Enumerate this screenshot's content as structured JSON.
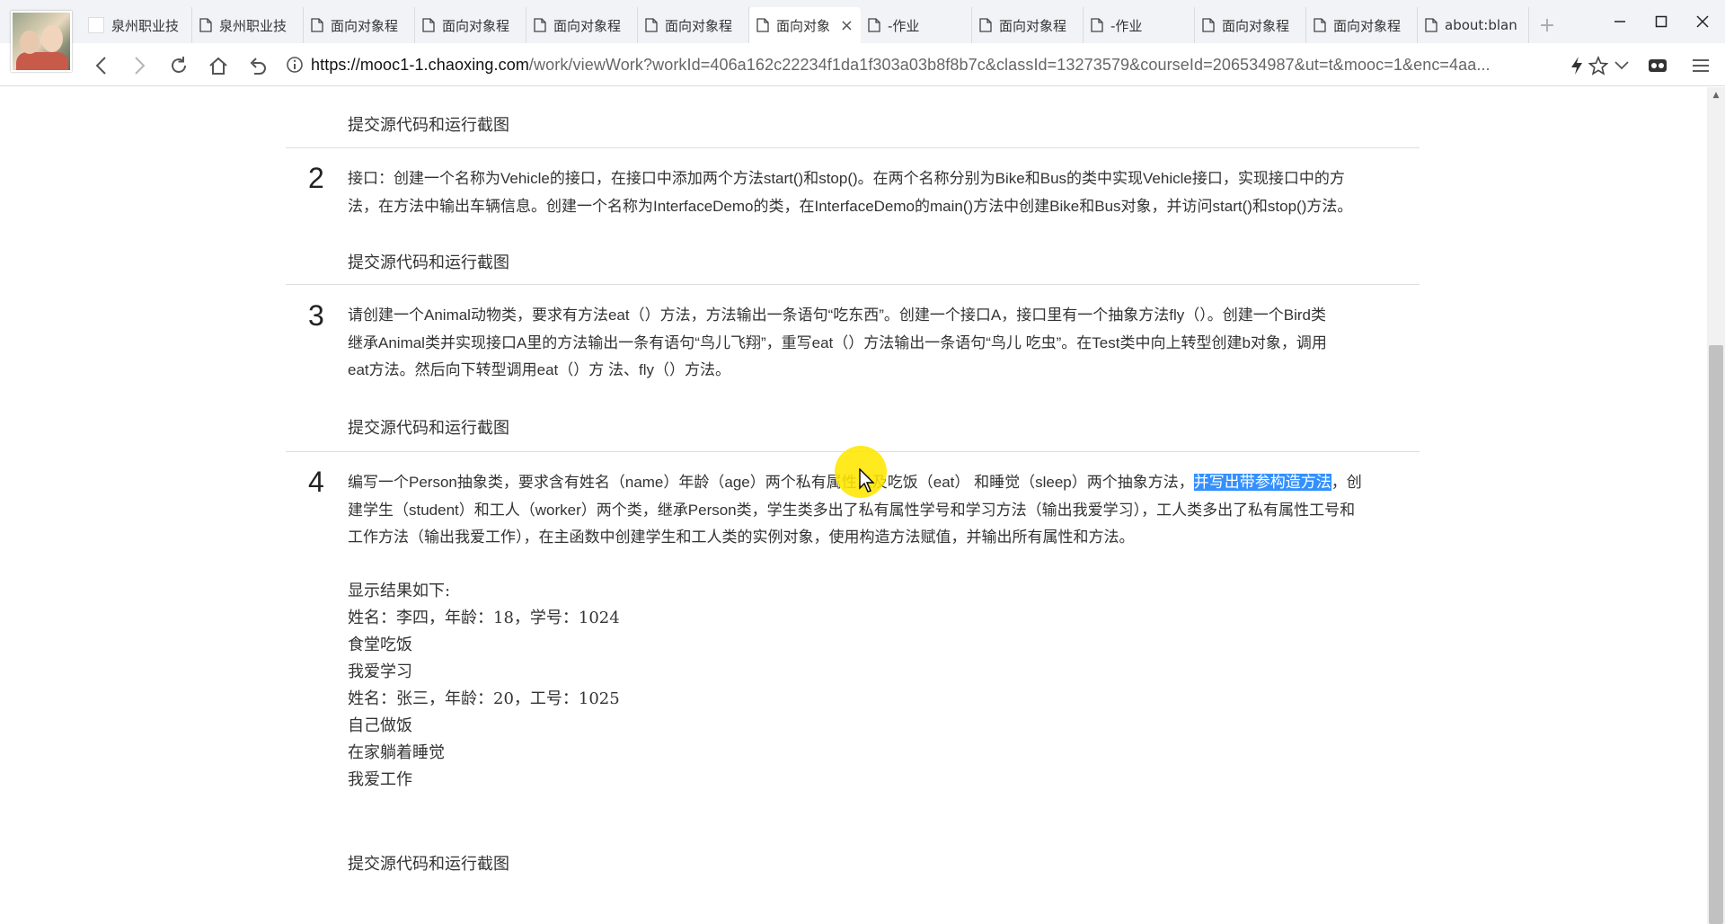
{
  "browser": {
    "tabs": [
      {
        "label": "泉州职业技",
        "icon": "blank-page-icon",
        "active": false
      },
      {
        "label": "泉州职业技",
        "icon": "document-icon",
        "active": false
      },
      {
        "label": "面向对象程",
        "icon": "document-icon",
        "active": false
      },
      {
        "label": "面向对象程",
        "icon": "document-icon",
        "active": false
      },
      {
        "label": "面向对象程",
        "icon": "document-icon",
        "active": false
      },
      {
        "label": "面向对象程",
        "icon": "document-icon",
        "active": false
      },
      {
        "label": "面向对象",
        "icon": "document-icon",
        "active": true
      },
      {
        "label": "-作业",
        "icon": "document-icon",
        "active": false
      },
      {
        "label": "面向对象程",
        "icon": "document-icon",
        "active": false
      },
      {
        "label": "-作业",
        "icon": "document-icon",
        "active": false
      },
      {
        "label": "面向对象程",
        "icon": "document-icon",
        "active": false
      },
      {
        "label": "面向对象程",
        "icon": "document-icon",
        "active": false
      },
      {
        "label": "about:blan",
        "icon": "document-icon",
        "active": false
      }
    ],
    "new_tab_label": "+",
    "tab_close_label": "×",
    "url_host": "https://mooc1-1.chaoxing.com",
    "url_rest": "/work/viewWork?workId=406a162c22234f1da1f303a03b8f8b7c&classId=13273579&courseId=206534987&ut=t&mooc=1&enc=4aa...",
    "accent_color": "#3390ff"
  },
  "page": {
    "submit_label": "提交源代码和运行截图",
    "questions": [
      {
        "number": "2",
        "lines": [
          " 接口：创建一个名称为Vehicle的接口，在接口中添加两个方法start()和stop()。在两个名称分别为Bike和Bus的类中实现Vehicle接口，实现接口中的方",
          "法，在方法中输出车辆信息。创建一个名称为InterfaceDemo的类，在InterfaceDemo的main()方法中创建Bike和Bus对象，并访问start()和stop()方法。"
        ]
      },
      {
        "number": "3",
        "lines": [
          "请创建一个Animal动物类，要求有方法eat（）方法，方法输出一条语句“吃东西”。创建一个接口A，接口里有一个抽象方法fly（）。创建一个Bird类",
          "继承Animal类并实现接口A里的方法输出一条有语句“鸟儿飞翔”，重写eat（）方法输出一条语句“鸟儿 吃虫”。在Test类中向上转型创建b对象，调用",
          "eat方法。然后向下转型调用eat（）方 法、fly（）方法。"
        ]
      },
      {
        "number": "4",
        "line1_before": "编写一个Person抽象类，要求含有姓名（name）年龄（age）两个私有属性以及吃饭（eat） 和睡觉（sleep）两个抽象方法，",
        "line1_highlight": "并写出带参构造方法",
        "line1_after": "，创",
        "lines": [
          "建学生（student）和工人（worker）两个类，继承Person类，学生类多出了私有属性学号和学习方法（输出我爱学习），工人类多出了私有属性工号和",
          "工作方法（输出我爱工作），在主函数中创建学生和工人类的实例对象，使用构造方法赋值，并输出所有属性和方法。"
        ],
        "result": [
          "显示结果如下:",
          "姓名：李四，年龄：18，学号：1024",
          "食堂吃饭",
          "我爱学习",
          "姓名：张三，年龄：20，工号：1025",
          "自己做饭",
          "在家躺着睡觉",
          "我爱工作"
        ]
      }
    ]
  }
}
